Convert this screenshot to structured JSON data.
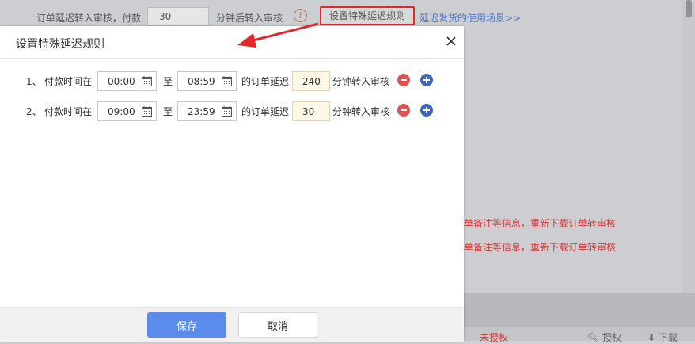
{
  "background": {
    "delay_label": "订单延迟转入审核，付款",
    "delay_value": "30",
    "delay_suffix": "分钟后转入审核",
    "info_icon": "info-icon",
    "rule_button": "设置特殊延迟规则",
    "usage_link": "延迟发货的使用场景>>",
    "warning_line_1": "单备注等信息，重新下载订单转审核",
    "warning_line_2": "单备注等信息，重新下载订单转审核",
    "unauthorized": "未授权",
    "authorize": "授权",
    "download": "下载"
  },
  "modal": {
    "title": "设置特殊延迟规则",
    "close_icon": "close-icon",
    "rules": [
      {
        "index": "1、",
        "label_pay_time": "付款时间在",
        "start": "00:00",
        "to": "至",
        "end": "08:59",
        "label_delay": "的订单延迟",
        "minutes": "240",
        "label_suffix": "分钟转入审核"
      },
      {
        "index": "2、",
        "label_pay_time": "付款时间在",
        "start": "09:00",
        "to": "至",
        "end": "23:59",
        "label_delay": "的订单延迟",
        "minutes": "30",
        "label_suffix": "分钟转入审核"
      }
    ],
    "save": "保存",
    "cancel": "取消"
  },
  "colors": {
    "primary": "#5b8ceb",
    "danger": "#e25050",
    "add": "#3e67b8",
    "annotation": "#e3282b"
  }
}
